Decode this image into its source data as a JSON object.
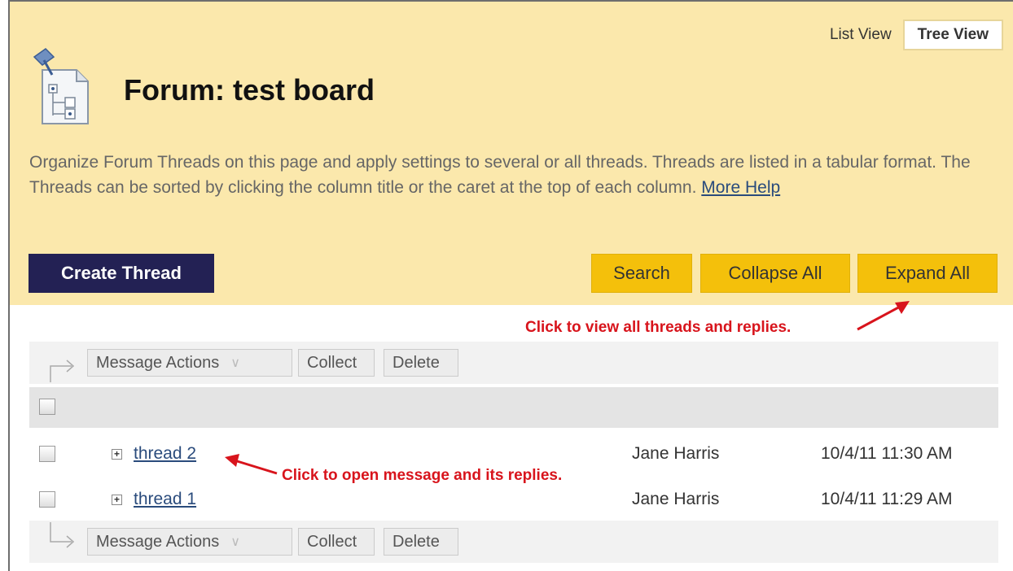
{
  "views": {
    "list": "List View",
    "tree": "Tree View"
  },
  "page": {
    "title": "Forum: test board",
    "description": "Organize Forum Threads on this page and apply settings to several or all threads. Threads are listed in a tabular format. The Threads can be sorted by clicking the column title or the caret at the top of each column.",
    "help_link": "More Help"
  },
  "buttons": {
    "create": "Create Thread",
    "search": "Search",
    "collapse": "Collapse All",
    "expand": "Expand All"
  },
  "annotations": {
    "expand_note": "Click to view all threads and replies.",
    "open_note": "Click to open message and its replies."
  },
  "toolbar": {
    "message_actions": "Message Actions",
    "collect": "Collect",
    "delete": "Delete"
  },
  "threads": [
    {
      "title": "thread 2",
      "author": "Jane Harris",
      "date": "10/4/11 11:30 AM"
    },
    {
      "title": "thread 1",
      "author": "Jane Harris",
      "date": "10/4/11 11:29 AM"
    }
  ],
  "colors": {
    "header_bg": "#fbe8ac",
    "create_btn": "#232154",
    "action_btn": "#f4c00b",
    "annotation": "#d8141c"
  },
  "icons": [
    "forum-icon",
    "expand-plus-icon",
    "chevron-down-icon",
    "tree-arrow-icon",
    "annotation-arrow-icon"
  ]
}
